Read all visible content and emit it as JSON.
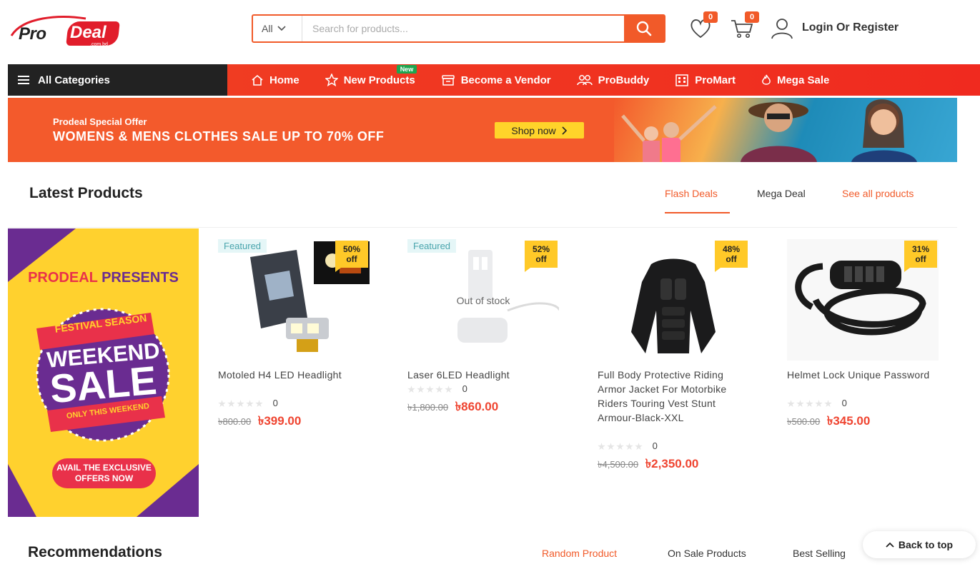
{
  "header": {
    "logo": {
      "pro": "Pro",
      "deal": "Deal",
      "sub": ".com.bd"
    },
    "search": {
      "category": "All",
      "placeholder": "Search for products..."
    },
    "wishlist_count": "0",
    "cart_count": "0",
    "login_label": "Login Or Register"
  },
  "nav": {
    "all_categories": "All Categories",
    "links": [
      {
        "label": "Home",
        "icon": "home-icon"
      },
      {
        "label": "New Products",
        "icon": "star-icon",
        "tag": "New"
      },
      {
        "label": "Become a Vendor",
        "icon": "store-icon"
      },
      {
        "label": "ProBuddy",
        "icon": "users-icon"
      },
      {
        "label": "ProMart",
        "icon": "building-icon"
      },
      {
        "label": "Mega Sale",
        "icon": "fire-icon"
      }
    ]
  },
  "banner": {
    "small": "Prodeal Special Offer",
    "big": "WOMENS & MENS CLOTHES SALE UP TO 70% OFF",
    "button": "Shop now"
  },
  "latest": {
    "title": "Latest Products",
    "tabs": [
      "Flash Deals",
      "Mega Deal",
      "See all products"
    ]
  },
  "promo": {
    "line1a": "PRODEAL",
    "line1b": "PRESENTS",
    "ribbon": "FESTIVAL SEASON",
    "weekend": "WEEKEND",
    "sale": "SALE",
    "only": "ONLY THIS WEEKEND",
    "cta1": "AVAIL THE EXCLUSIVE",
    "cta2": "OFFERS NOW"
  },
  "products": [
    {
      "featured": "Featured",
      "off_pct": "50%",
      "off": "off",
      "name": "Motoled H4 LED Headlight",
      "rating": "0",
      "old_price": "৳800.00",
      "new_price": "৳399.00"
    },
    {
      "featured": "Featured",
      "off_pct": "52%",
      "off": "off",
      "name": "Laser 6LED Headlight",
      "stock": "Out of stock",
      "rating": "0",
      "old_price": "৳1,800.00",
      "new_price": "৳860.00"
    },
    {
      "off_pct": "48%",
      "off": "off",
      "name": "Full Body Protective Riding Armor Jacket For Motorbike Riders Touring Vest Stunt Armour-Black-XXL",
      "rating": "0",
      "old_price": "৳4,500.00",
      "new_price": "৳2,350.00"
    },
    {
      "off_pct": "31%",
      "off": "off",
      "name": "Helmet Lock Unique Password",
      "rating": "0",
      "old_price": "৳500.00",
      "new_price": "৳345.00"
    }
  ],
  "recommendations": {
    "title": "Recommendations",
    "tabs": [
      "Random Product",
      "On Sale Products",
      "Best Selling"
    ]
  },
  "back_to_top": "Back to top",
  "colors": {
    "accent": "#f15a29",
    "nav_red": "#f02a1f",
    "dark": "#222222",
    "price_red": "#ef4430",
    "promo_yellow": "#ffd12e",
    "promo_purple": "#6a2c91"
  }
}
